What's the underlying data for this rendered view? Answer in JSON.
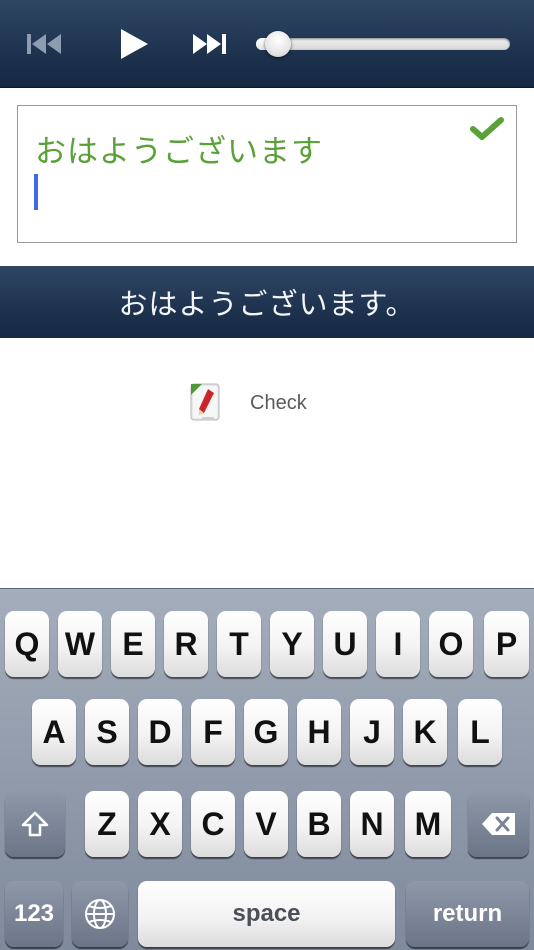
{
  "player": {
    "prev_icon": "skip-back-icon",
    "play_icon": "play-icon",
    "next_icon": "skip-forward-icon",
    "progress": 0.04
  },
  "answer": {
    "text": "おはようございます",
    "status_icon": "checkmark-icon",
    "status_color": "#5aa13a"
  },
  "sentence": {
    "text": "おはようございます。"
  },
  "check_button": {
    "label": "Check",
    "icon": "pencil-check-icon"
  },
  "keyboard": {
    "row1": [
      "Q",
      "W",
      "E",
      "R",
      "T",
      "Y",
      "U",
      "I",
      "O",
      "P"
    ],
    "row2": [
      "A",
      "S",
      "D",
      "F",
      "G",
      "H",
      "J",
      "K",
      "L"
    ],
    "row3": [
      "Z",
      "X",
      "C",
      "V",
      "B",
      "N",
      "M"
    ],
    "shift_icon": "shift-icon",
    "delete_icon": "backspace-icon",
    "globe_icon": "globe-icon",
    "numbers_label": "123",
    "space_label": "space",
    "return_label": "return"
  },
  "colors": {
    "bar": "#1f3450",
    "answer_text": "#5aa13a",
    "caret": "#3d6ae5"
  }
}
